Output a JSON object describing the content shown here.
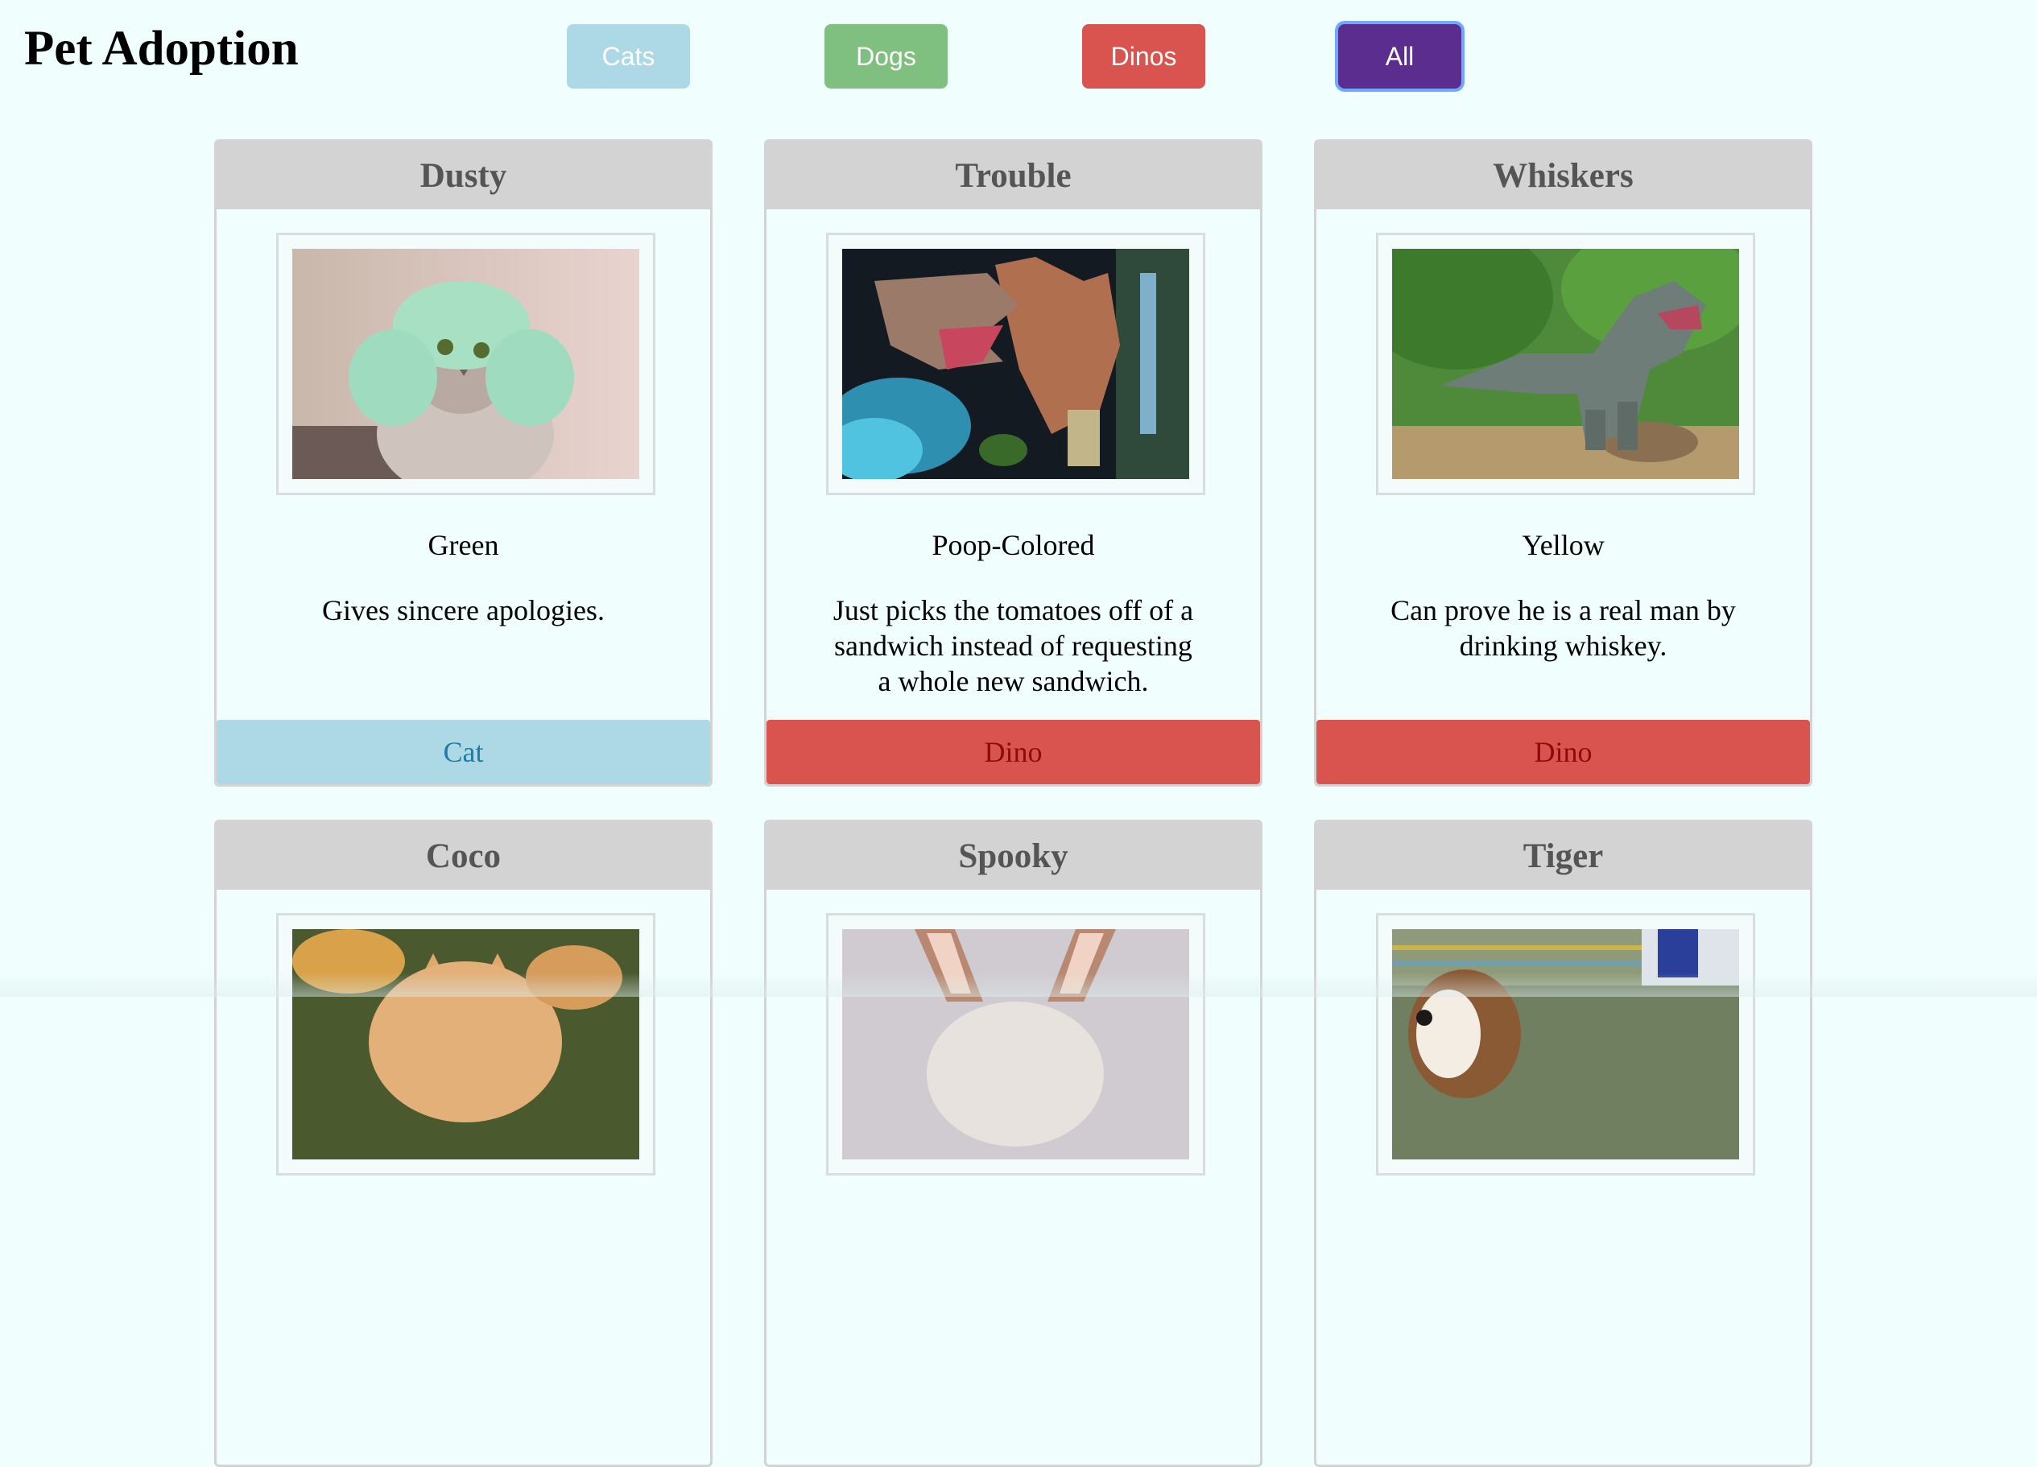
{
  "header": {
    "title": "Pet Adoption"
  },
  "filters": [
    {
      "label": "Cats",
      "color": "#add8e6",
      "active": false
    },
    {
      "label": "Dogs",
      "color": "#7fbf7f",
      "active": false
    },
    {
      "label": "Dinos",
      "color": "#d9534f",
      "active": false
    },
    {
      "label": "All",
      "color": "#5b2d8e",
      "active": true
    }
  ],
  "pets": [
    {
      "name": "Dusty",
      "color": "Green",
      "description": "Gives sincere apologies.",
      "type": "Cat",
      "image": "cat-in-green-hat"
    },
    {
      "name": "Trouble",
      "color": "Poop-Colored",
      "description": "Just picks the tomatoes off of a sandwich instead of requesting a whole new sandwich.",
      "type": "Dino",
      "image": "spinosaurus-model"
    },
    {
      "name": "Whiskers",
      "color": "Yellow",
      "description": "Can prove he is a real man by drinking whiskey.",
      "type": "Dino",
      "image": "t-rex-statue-in-forest"
    },
    {
      "name": "Coco",
      "color": "",
      "description": "",
      "type": "",
      "image": "orange-cat-outdoors"
    },
    {
      "name": "Spooky",
      "color": "",
      "description": "",
      "type": "",
      "image": "cat-with-big-ears"
    },
    {
      "name": "Tiger",
      "color": "",
      "description": "",
      "type": "",
      "image": "basset-hound"
    }
  ]
}
